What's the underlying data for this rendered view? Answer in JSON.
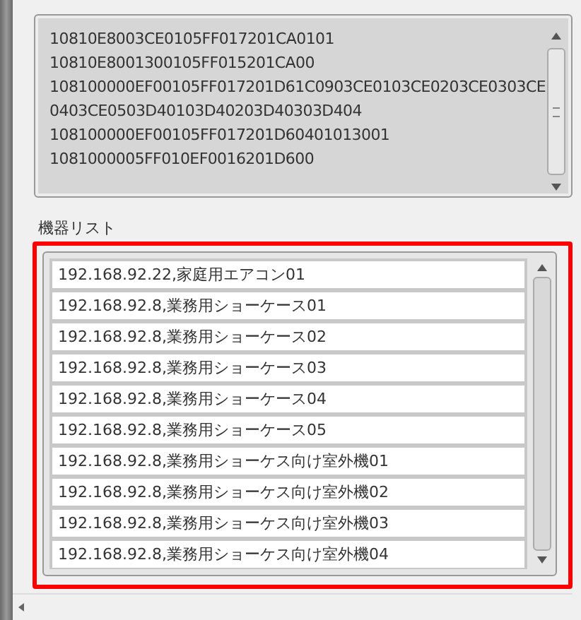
{
  "log_box": {
    "lines": [
      "10810E8003CE0105FF017201CA0101",
      "10810E8001300105FF015201CA00",
      "108100000EF00105FF017201D61C0903CE0103CE0203CE0303CE",
      "0403CE0503D40103D40203D40303D404",
      "108100000EF00105FF017201D60401013001",
      "1081000005FF010EF0016201D600"
    ]
  },
  "device_list": {
    "label": "機器リスト",
    "highlighted": true,
    "items": [
      {
        "text": "192.168.92.22,家庭用エアコン01"
      },
      {
        "text": "192.168.92.8,業務用ショーケース01"
      },
      {
        "text": "192.168.92.8,業務用ショーケース02"
      },
      {
        "text": "192.168.92.8,業務用ショーケース03"
      },
      {
        "text": "192.168.92.8,業務用ショーケース04"
      },
      {
        "text": "192.168.92.8,業務用ショーケース05"
      },
      {
        "text": "192.168.92.8,業務用ショーケス向け室外機01"
      },
      {
        "text": "192.168.92.8,業務用ショーケス向け室外機02"
      },
      {
        "text": "192.168.92.8,業務用ショーケス向け室外機03"
      },
      {
        "text": "192.168.92.8,業務用ショーケス向け室外機04"
      }
    ]
  }
}
